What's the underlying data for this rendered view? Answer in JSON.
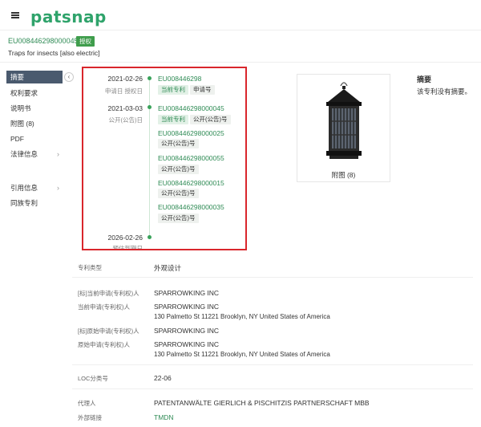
{
  "header": {
    "logo": "patsnap"
  },
  "patent": {
    "number": "EU008446298000045",
    "status": "授权",
    "title": "Traps for insects [also electric]"
  },
  "sidebar": {
    "items": [
      {
        "label": "摘要"
      },
      {
        "label": "权利要求"
      },
      {
        "label": "说明书"
      },
      {
        "label": "附图 (8)"
      },
      {
        "label": "PDF"
      },
      {
        "label": "法律信息"
      },
      {
        "label": "引用信息"
      },
      {
        "label": "同族专利"
      }
    ],
    "collapse_label": "‹"
  },
  "timeline": {
    "event1": {
      "date": "2021-02-26",
      "sub": "申请日 授权日",
      "link": "EU008446298",
      "tags": [
        "当前专利",
        "申请号"
      ]
    },
    "event2": {
      "date": "2021-03-03",
      "sub": "公开(公告)日",
      "entries": [
        {
          "link": "EU008446298000045",
          "tags": [
            "当前专利",
            "公开(公告)号"
          ]
        },
        {
          "link": "EU008446298000025",
          "tags": [
            "公开(公告)号"
          ]
        },
        {
          "link": "EU008446298000055",
          "tags": [
            "公开(公告)号"
          ]
        },
        {
          "link": "EU008446298000015",
          "tags": [
            "公开(公告)号"
          ]
        },
        {
          "link": "EU008446298000035",
          "tags": [
            "公开(公告)号"
          ]
        }
      ]
    },
    "event3": {
      "date": "2026-02-26",
      "sub": "预估到期日"
    }
  },
  "figure": {
    "caption": "附图 (8)"
  },
  "abstract": {
    "title": "摘要",
    "text": "该专利没有摘要。"
  },
  "info": {
    "type_label": "专利类型",
    "type_value": "外观设计",
    "orig_applicant_label": "[标]当前申请(专利权)人",
    "orig_applicant_value": "SPARROWKING INC",
    "cur_applicant_label": "当前申请(专利权)人",
    "cur_applicant_value": "SPARROWKING INC",
    "cur_applicant_addr": "130 Palmetto St 11221 Brooklyn, NY United States of America",
    "orig2_label": "[标]原始申请(专利权)人",
    "orig2_value": "SPARROWKING INC",
    "raw_applicant_label": "原始申请(专利权)人",
    "raw_applicant_value": "SPARROWKING INC",
    "raw_applicant_addr": "130 Palmetto St 11221 Brooklyn, NY United States of America",
    "loc_label": "LOC分类号",
    "loc_value": "22-06",
    "agent_label": "代理人",
    "agent_value": "PATENTANWÄLTE GIERLICH & PISCHITZIS PARTNERSCHAFT MBB",
    "ext_label": "外部链接",
    "ext_value": "TMDN"
  },
  "colors": {
    "brand": "#2fa36b",
    "link": "#2f8b55",
    "highlight_border": "#d9262c",
    "sidebar_active": "#4a5a6e"
  }
}
